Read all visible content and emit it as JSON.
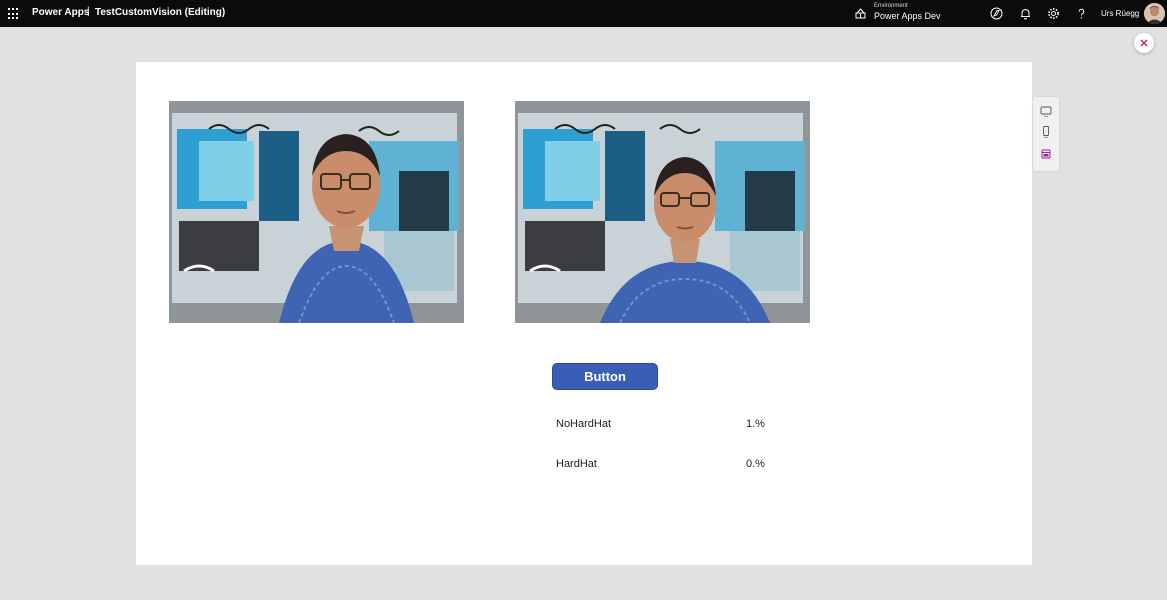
{
  "header": {
    "app_name": "Power Apps",
    "separator": "|",
    "doc_title": "TestCustomVision (Editing)",
    "environment_label": "Environment",
    "environment_name": "Power Apps Dev",
    "user_name": "Urs Rüegg",
    "icons": [
      "waffle-icon",
      "environment-icon",
      "power-automate-icon",
      "bell-icon",
      "gear-icon",
      "help-icon",
      "avatar"
    ]
  },
  "canvas": {
    "button_label": "Button",
    "results": [
      {
        "tag": "NoHardHat",
        "percent": "1.%"
      },
      {
        "tag": "HardHat",
        "percent": "0.%"
      }
    ]
  },
  "side_panel": {
    "icons": [
      "tablet-icon",
      "phone-icon",
      "calendar-icon"
    ]
  },
  "colors": {
    "topbar": "#0b0b0b",
    "button": "#3a5eb5",
    "page_background": "#e1e1e1",
    "close_accent": "#c2185b",
    "side_accent": "#a1208e"
  }
}
